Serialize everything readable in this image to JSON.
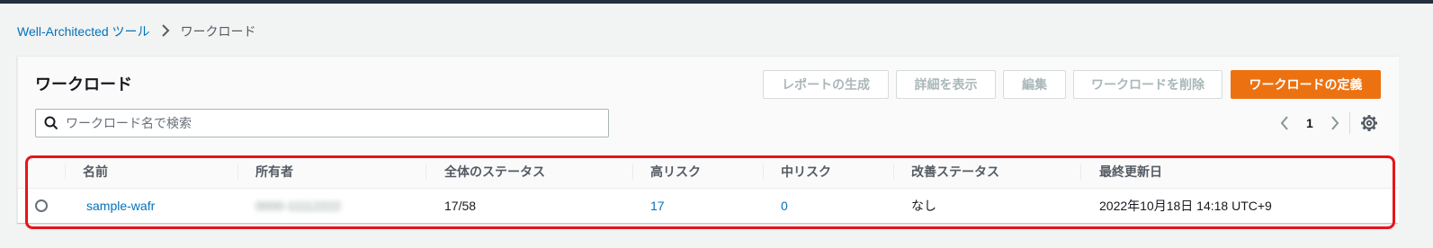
{
  "breadcrumb": {
    "root": "Well-Architected ツール",
    "current": "ワークロード"
  },
  "panel": {
    "title": "ワークロード"
  },
  "buttons": {
    "generate_report": "レポートの生成",
    "view_details": "詳細を表示",
    "edit": "編集",
    "delete_workload": "ワークロードを削除",
    "define_workload": "ワークロードの定義"
  },
  "search": {
    "placeholder": "ワークロード名で検索",
    "value": ""
  },
  "pagination": {
    "current_page": "1"
  },
  "table": {
    "columns": [
      "名前",
      "所有者",
      "全体のステータス",
      "高リスク",
      "中リスク",
      "改善ステータス",
      "最終更新日"
    ],
    "rows": [
      {
        "name": "sample-wafr",
        "owner": "0000-11112222",
        "overall_status": "17/58",
        "high_risk": "17",
        "medium_risk": "0",
        "improvement_status": "なし",
        "last_updated": "2022年10月18日 14:18 UTC+9"
      }
    ]
  },
  "colors": {
    "primary": "#ec7211",
    "link": "#0073bb",
    "highlight": "#e8141a",
    "topbar": "#232f3e"
  },
  "icons": [
    "chevron-right-icon",
    "search-icon",
    "chevron-left-icon",
    "chevron-right-icon",
    "gear-icon"
  ]
}
